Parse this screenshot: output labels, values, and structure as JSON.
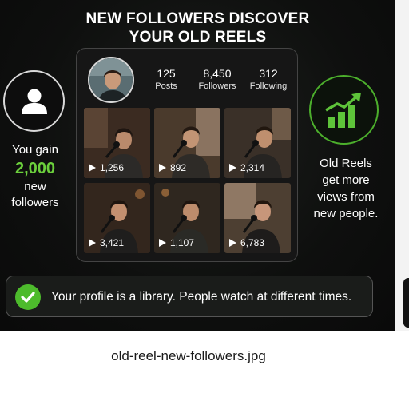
{
  "headline": {
    "line1": "NEW FOLLOWERS DISCOVER",
    "line2": "YOUR OLD REELS"
  },
  "left_panel": {
    "icon": "user-icon",
    "line1": "You gain",
    "number": "2,000",
    "line2": "new followers"
  },
  "right_panel": {
    "icon": "growth-chart-icon",
    "lines": [
      "Old Reels",
      "get more",
      "views from",
      "new people."
    ]
  },
  "profile": {
    "stats": [
      {
        "value": "125",
        "label": "Posts"
      },
      {
        "value": "8,450",
        "label": "Followers"
      },
      {
        "value": "312",
        "label": "Following"
      }
    ],
    "reels": [
      {
        "views": "1,256"
      },
      {
        "views": "892"
      },
      {
        "views": "2,314"
      },
      {
        "views": "3,421"
      },
      {
        "views": "1,107"
      },
      {
        "views": "6,783"
      }
    ]
  },
  "banner": {
    "icon": "checkmark-icon",
    "text": "Your profile is a library. People watch at different times."
  },
  "caption": "old-reel-new-followers.jpg",
  "colors": {
    "accent_green": "#6bcf3c",
    "check_green": "#4dbb2c",
    "background": "#0e0f0e"
  }
}
